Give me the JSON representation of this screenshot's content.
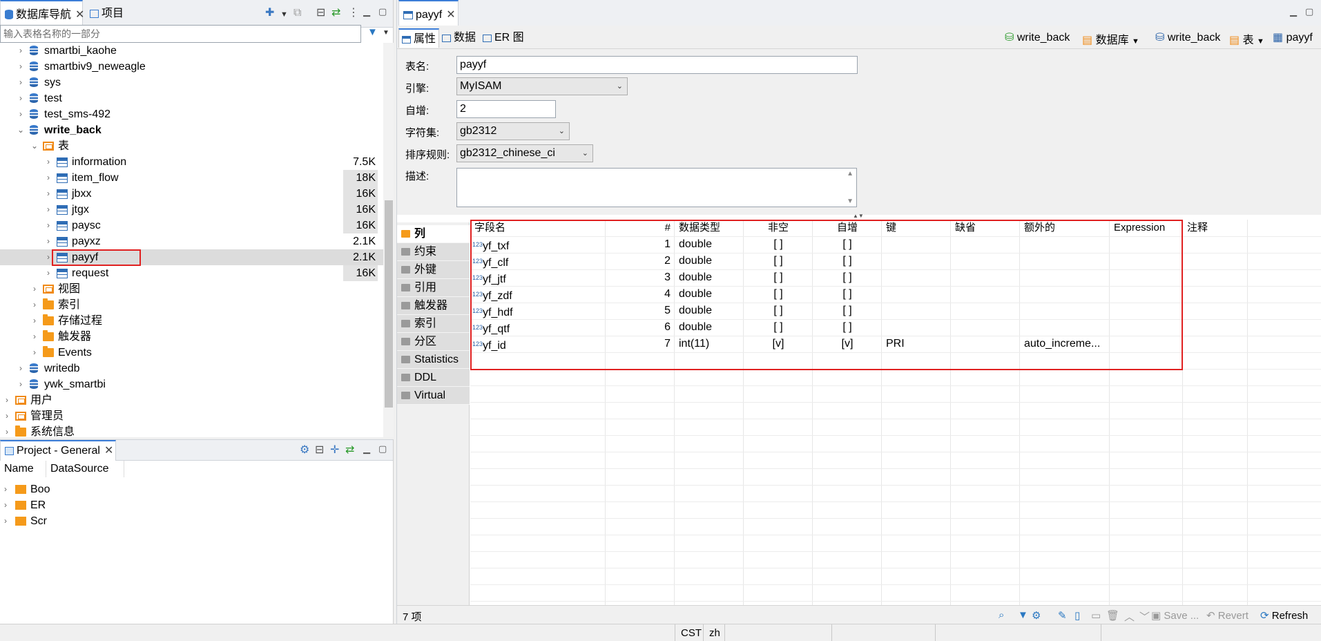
{
  "nav": {
    "tab_db": "数据库导航",
    "tab_project": "项目",
    "filter_placeholder": "输入表格名称的一部分",
    "tree": [
      {
        "label": "smartbi_kaohe",
        "level": 2,
        "kind": "db"
      },
      {
        "label": "smartbiv9_neweagle",
        "level": 2,
        "kind": "db"
      },
      {
        "label": "sys",
        "level": 2,
        "kind": "db"
      },
      {
        "label": "test",
        "level": 2,
        "kind": "db"
      },
      {
        "label": "test_sms-492",
        "level": 2,
        "kind": "db"
      },
      {
        "label": "write_back",
        "level": 2,
        "kind": "db",
        "expanded": true,
        "bold": true
      },
      {
        "label": "表",
        "level": 3,
        "kind": "tables",
        "expanded": true
      },
      {
        "label": "information",
        "level": 4,
        "kind": "table",
        "size": "7.5K"
      },
      {
        "label": "item_flow",
        "level": 4,
        "kind": "table",
        "size": "18K"
      },
      {
        "label": "jbxx",
        "level": 4,
        "kind": "table",
        "size": "16K"
      },
      {
        "label": "jtgx",
        "level": 4,
        "kind": "table",
        "size": "16K"
      },
      {
        "label": "paysc",
        "level": 4,
        "kind": "table",
        "size": "16K"
      },
      {
        "label": "payxz",
        "level": 4,
        "kind": "table",
        "size": "2.1K"
      },
      {
        "label": "payyf",
        "level": 4,
        "kind": "table",
        "size": "2.1K",
        "selected": true
      },
      {
        "label": "request",
        "level": 4,
        "kind": "table",
        "size": "16K"
      },
      {
        "label": "视图",
        "level": 3,
        "kind": "views"
      },
      {
        "label": "索引",
        "level": 3,
        "kind": "folder"
      },
      {
        "label": "存储过程",
        "level": 3,
        "kind": "folder"
      },
      {
        "label": "触发器",
        "level": 3,
        "kind": "folder"
      },
      {
        "label": "Events",
        "level": 3,
        "kind": "folder"
      },
      {
        "label": "writedb",
        "level": 2,
        "kind": "db"
      },
      {
        "label": "ywk_smartbi",
        "level": 2,
        "kind": "db"
      },
      {
        "label": "用户",
        "level": 1,
        "kind": "users"
      },
      {
        "label": "管理员",
        "level": 1,
        "kind": "admins"
      },
      {
        "label": "系统信息",
        "level": 1,
        "kind": "sysinfo"
      }
    ]
  },
  "project": {
    "tab": "Project - General",
    "col_name": "Name",
    "col_ds": "DataSource",
    "items": [
      "Boo",
      "ER",
      "Scr"
    ]
  },
  "editor": {
    "tab": "payyf",
    "subtabs": [
      "属性",
      "数据",
      "ER 图"
    ],
    "crumbs": {
      "conn": "write_back",
      "db_label": "数据库",
      "db": "write_back",
      "tbl_label": "表",
      "tbl": "payyf"
    },
    "props": {
      "name_label": "表名:",
      "name": "payyf",
      "engine_label": "引擎:",
      "engine": "MyISAM",
      "autoinc_label": "自增:",
      "autoinc": "2",
      "charset_label": "字符集:",
      "charset": "gb2312",
      "collation_label": "排序规则:",
      "collation": "gb2312_chinese_ci",
      "desc_label": "描述:"
    },
    "vtabs": [
      "列",
      "约束",
      "外键",
      "引用",
      "触发器",
      "索引",
      "分区",
      "Statistics",
      "DDL",
      "Virtual"
    ],
    "grid": {
      "headers": [
        "字段名",
        "#",
        "数据类型",
        "非空",
        "自增",
        "键",
        "缺省",
        "额外的",
        "Expression",
        "注释"
      ],
      "rows": [
        {
          "name": "yf_txf",
          "n": "1",
          "type": "double",
          "nn": "[ ]",
          "ai": "[ ]",
          "key": "",
          "extra": ""
        },
        {
          "name": "yf_clf",
          "n": "2",
          "type": "double",
          "nn": "[ ]",
          "ai": "[ ]",
          "key": "",
          "extra": ""
        },
        {
          "name": "yf_jtf",
          "n": "3",
          "type": "double",
          "nn": "[ ]",
          "ai": "[ ]",
          "key": "",
          "extra": ""
        },
        {
          "name": "yf_zdf",
          "n": "4",
          "type": "double",
          "nn": "[ ]",
          "ai": "[ ]",
          "key": "",
          "extra": ""
        },
        {
          "name": "yf_hdf",
          "n": "5",
          "type": "double",
          "nn": "[ ]",
          "ai": "[ ]",
          "key": "",
          "extra": ""
        },
        {
          "name": "yf_qtf",
          "n": "6",
          "type": "double",
          "nn": "[ ]",
          "ai": "[ ]",
          "key": "",
          "extra": ""
        },
        {
          "name": "yf_id",
          "n": "7",
          "type": "int(11)",
          "nn": "[v]",
          "ai": "[v]",
          "key": "PRI",
          "extra": "auto_increme..."
        }
      ]
    },
    "count": "7 项",
    "buttons": {
      "save": "Save ...",
      "revert": "Revert",
      "refresh": "Refresh"
    }
  },
  "status": {
    "tz": "CST",
    "locale": "zh"
  }
}
